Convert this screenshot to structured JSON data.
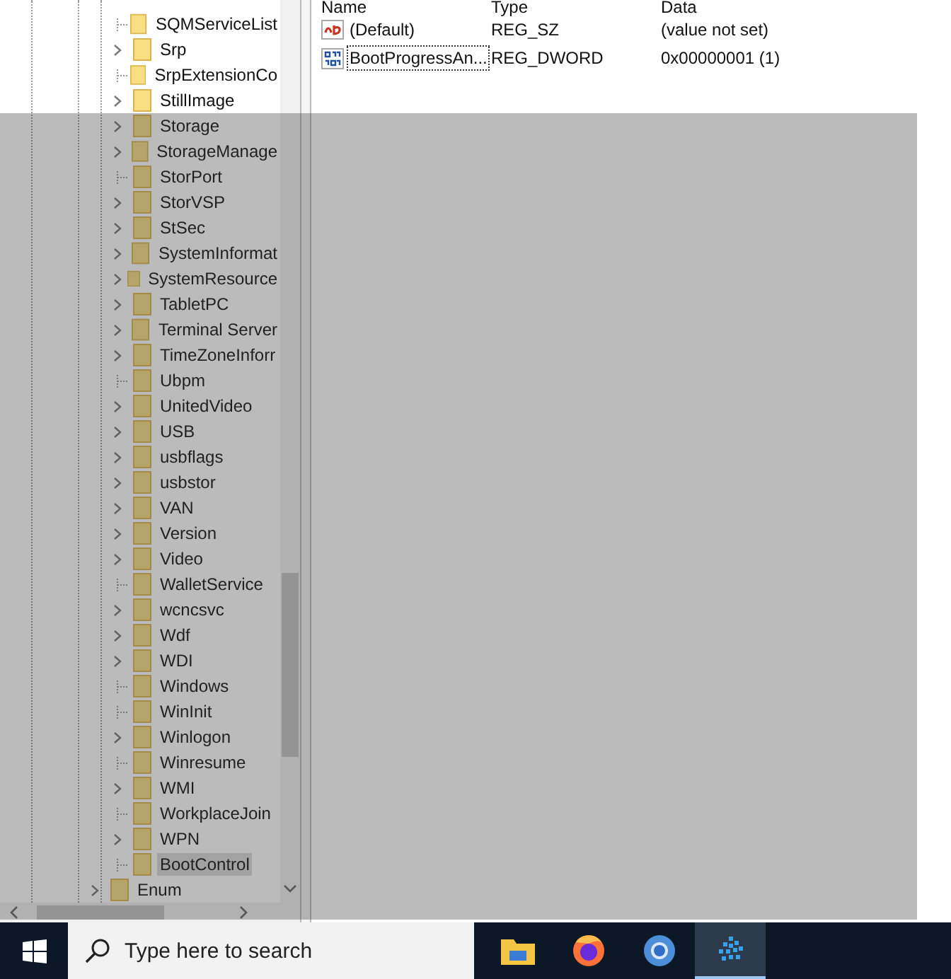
{
  "tree": {
    "items": [
      {
        "label": "SQMServiceList",
        "has_children": false,
        "selected": false
      },
      {
        "label": "Srp",
        "has_children": true,
        "selected": false
      },
      {
        "label": "SrpExtensionCo",
        "has_children": false,
        "selected": false
      },
      {
        "label": "StillImage",
        "has_children": true,
        "selected": false
      },
      {
        "label": "Storage",
        "has_children": true,
        "selected": false
      },
      {
        "label": "StorageManage",
        "has_children": true,
        "selected": false
      },
      {
        "label": "StorPort",
        "has_children": false,
        "selected": false
      },
      {
        "label": "StorVSP",
        "has_children": true,
        "selected": false
      },
      {
        "label": "StSec",
        "has_children": true,
        "selected": false
      },
      {
        "label": "SystemInformat",
        "has_children": true,
        "selected": false
      },
      {
        "label": "SystemResource",
        "has_children": true,
        "selected": false
      },
      {
        "label": "TabletPC",
        "has_children": true,
        "selected": false
      },
      {
        "label": "Terminal Server",
        "has_children": true,
        "selected": false
      },
      {
        "label": "TimeZoneInforr",
        "has_children": true,
        "selected": false
      },
      {
        "label": "Ubpm",
        "has_children": false,
        "selected": false
      },
      {
        "label": "UnitedVideo",
        "has_children": true,
        "selected": false
      },
      {
        "label": "USB",
        "has_children": true,
        "selected": false
      },
      {
        "label": "usbflags",
        "has_children": true,
        "selected": false
      },
      {
        "label": "usbstor",
        "has_children": true,
        "selected": false
      },
      {
        "label": "VAN",
        "has_children": true,
        "selected": false
      },
      {
        "label": "Version",
        "has_children": true,
        "selected": false
      },
      {
        "label": "Video",
        "has_children": true,
        "selected": false
      },
      {
        "label": "WalletService",
        "has_children": false,
        "selected": false
      },
      {
        "label": "wcncsvc",
        "has_children": true,
        "selected": false
      },
      {
        "label": "Wdf",
        "has_children": true,
        "selected": false
      },
      {
        "label": "WDI",
        "has_children": true,
        "selected": false
      },
      {
        "label": "Windows",
        "has_children": false,
        "selected": false
      },
      {
        "label": "WinInit",
        "has_children": false,
        "selected": false
      },
      {
        "label": "Winlogon",
        "has_children": true,
        "selected": false
      },
      {
        "label": "Winresume",
        "has_children": false,
        "selected": false
      },
      {
        "label": "WMI",
        "has_children": true,
        "selected": false
      },
      {
        "label": "WorkplaceJoin",
        "has_children": false,
        "selected": false
      },
      {
        "label": "WPN",
        "has_children": true,
        "selected": false
      },
      {
        "label": "BootControl",
        "has_children": false,
        "selected": true
      }
    ],
    "parent_sibling": {
      "label": "Enum",
      "has_children": true,
      "selected": false
    }
  },
  "values": {
    "columns": [
      "Name",
      "Type",
      "Data"
    ],
    "rows": [
      {
        "kind": "string",
        "name": "(Default)",
        "type": "REG_SZ",
        "data": "(value not set)",
        "focused": false
      },
      {
        "kind": "binary",
        "name": "BootProgressAn...",
        "type": "REG_DWORD",
        "data": "0x00000001 (1)",
        "focused": true
      }
    ]
  },
  "taskbar": {
    "search_placeholder": "Type here to search",
    "apps": [
      {
        "kind": "explorer",
        "active": false
      },
      {
        "kind": "firefox",
        "active": false
      },
      {
        "kind": "chrome",
        "active": false
      },
      {
        "kind": "app",
        "active": true
      }
    ]
  }
}
